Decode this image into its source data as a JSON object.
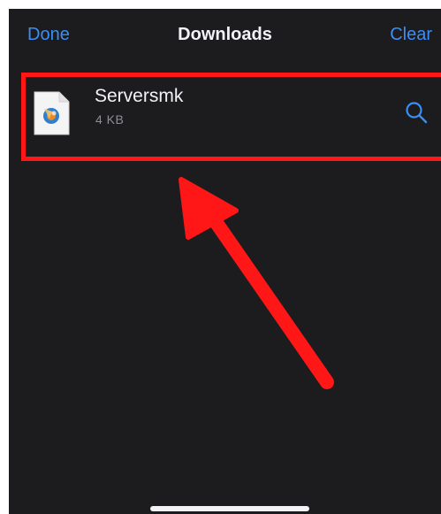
{
  "nav": {
    "done_label": "Done",
    "title": "Downloads",
    "clear_label": "Clear"
  },
  "file": {
    "name": "Serversmk",
    "size": "4 KB",
    "icon": "installer-file-icon"
  },
  "actions": {
    "search_icon": "search-icon"
  },
  "colors": {
    "background": "#1c1c1e",
    "accent": "#3a8ef5",
    "highlight": "#ff1616",
    "primary_text": "#f2f2f7",
    "secondary_text": "#8e8e93"
  }
}
